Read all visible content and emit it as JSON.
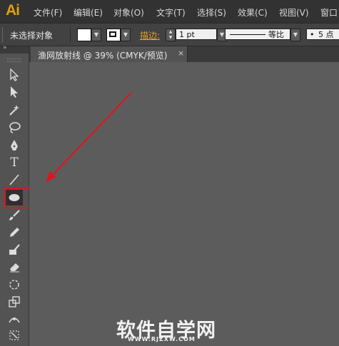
{
  "app": {
    "logo": "Ai"
  },
  "menu": {
    "file": "文件(F)",
    "edit": "编辑(E)",
    "object": "对象(O)",
    "type": "文字(T)",
    "select": "选择(S)",
    "effect": "效果(C)",
    "view": "视图(V)",
    "window": "窗口"
  },
  "control": {
    "selection_status": "未选择对象",
    "stroke_label": "描边:",
    "stroke_weight": "1 pt",
    "profile": "等比",
    "brush_size": "5 点"
  },
  "document": {
    "tab_title": "渔网放射线 @ 39% (CMYK/预览)",
    "close_symbol": "×"
  },
  "watermark": {
    "text": "软件自学网",
    "sub": "WWW.RJZXW.COM"
  },
  "colors": {
    "menubar": "#323232",
    "canvas": "#5c5c5c",
    "highlight": "#e0141e",
    "arrow": "#e0141e",
    "logo": "#e0a00f"
  },
  "tools": [
    "selection-tool",
    "direct-selection-tool",
    "magic-wand-tool",
    "lasso-tool",
    "pen-tool",
    "type-tool",
    "line-tool",
    "ellipse-tool",
    "paintbrush-tool",
    "pencil-tool",
    "blob-brush-tool",
    "eraser-tool",
    "rotate-tool",
    "scale-tool",
    "width-tool",
    "free-transform-tool"
  ]
}
